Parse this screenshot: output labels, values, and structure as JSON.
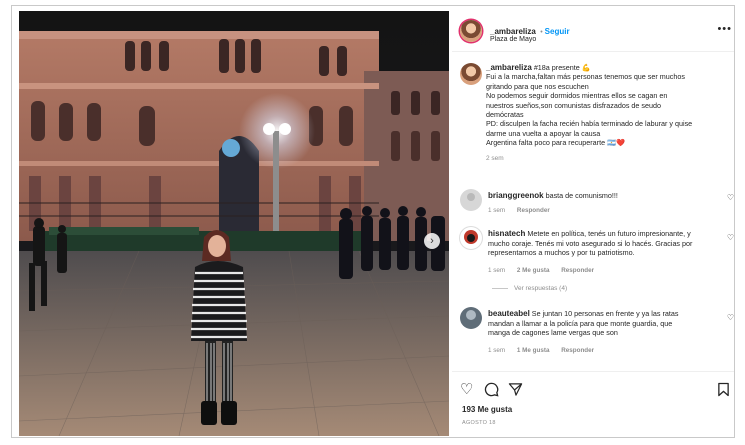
{
  "post": {
    "author": "_ambareliza",
    "follow_label": "Seguir",
    "location": "Plaza de Mayo",
    "more_icon": "ellipsis-icon",
    "caption": {
      "author": "_ambareliza",
      "lines": [
        "#18a presente 💪",
        "Fui a la marcha,faltan más personas tenemos que ser muchos",
        "gritando para que nos escuchen",
        "No podemos seguir dormidos mientras ellos se cagan en",
        "nuestros sueños,son comunistas disfrazados de seudo",
        "demócratas",
        "PD: disculpen la facha recién había terminado de laburar y quise",
        "darme una vuelta a apoyar la causa",
        "Argentina falta poco para recuperarte 🇦🇷❤️"
      ],
      "time": "2 sem"
    },
    "comments": [
      {
        "user": "brianggreenok",
        "lines": [
          "basta de comunismo!!!"
        ],
        "time": "1 sem",
        "likes": "",
        "reply": "Responder"
      },
      {
        "user": "hisnatech",
        "lines": [
          "Metete en política, tenés un futuro impresionante, y",
          "mucho coraje. Tenés mi voto asegurado si lo hacés. Gracias por",
          "representarnos a muchos y por tu patriotismo."
        ],
        "time": "1 sem",
        "likes": "2 Me gusta",
        "reply": "Responder",
        "view_replies": "Ver respuestas (4)"
      },
      {
        "user": "beauteabel",
        "lines": [
          "Se juntan 10 personas en frente y ya las ratas",
          "mandan a llamar a la policía para que monte guardia, que",
          "manga de cagones lame vergas que son"
        ],
        "time": "1 sem",
        "likes": "1 Me gusta",
        "reply": "Responder"
      }
    ],
    "likes_count": "193 Me gusta",
    "date": "AGOSTO 18"
  },
  "icons": {
    "like": "heart-icon",
    "comment": "comment-bubble-icon",
    "share": "paper-plane-icon",
    "save": "bookmark-icon",
    "next": "chevron-right-icon"
  }
}
